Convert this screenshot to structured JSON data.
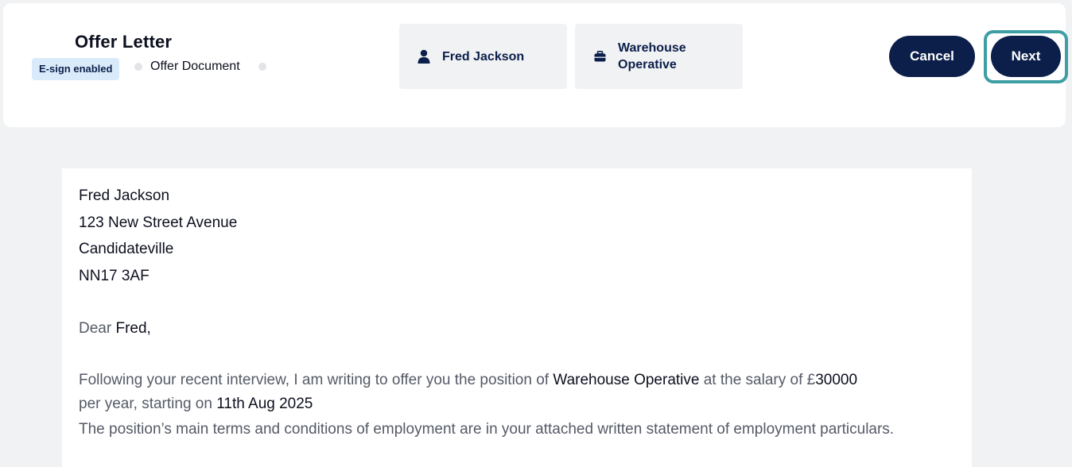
{
  "header": {
    "title": "Offer Letter",
    "tag": "E-sign enabled",
    "breadcrumb": "Offer Document",
    "cards": [
      {
        "icon": "person-icon",
        "label": "Fred Jackson"
      },
      {
        "icon": "briefcase-icon",
        "label_line1": "Warehouse",
        "label_line2": "Operative"
      }
    ],
    "cancel_label": "Cancel",
    "next_label": "Next"
  },
  "letter": {
    "address": [
      "Fred Jackson",
      "123 New Street Avenue",
      "Candidateville",
      "NN17 3AF"
    ],
    "greeting_prefix": "Dear",
    "greeting_name": "Fred,",
    "p1_a": "Following your recent interview, I am writing to offer you the position of",
    "p1_position": "Warehouse Operative",
    "p1_b": "at the salary of £",
    "p1_salary": "30000",
    "p1_c": "per year, starting on",
    "p1_date": "11th Aug 2025",
    "p2": "The position’s main terms and conditions of employment are in your attached written statement of employment particulars."
  },
  "colors": {
    "brand_navy": "#0c1f4a",
    "focus_ring": "#3d9ea4",
    "tag_bg": "#d9ebfb",
    "page_bg": "#f1f2f4"
  }
}
